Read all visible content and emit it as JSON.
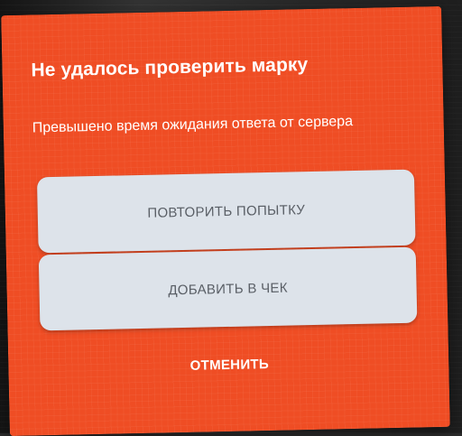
{
  "dialog": {
    "title": "Не удалось проверить марку",
    "message": "Превышено время ожидания ответа от сервера",
    "retry_label": "ПОВТОРИТЬ ПОПЫТКУ",
    "add_label": "ДОБАВИТЬ В ЧЕК",
    "cancel_label": "ОТМЕНИТЬ"
  },
  "colors": {
    "dialog_background": "#ef4d24",
    "button_background": "#dde3ea",
    "button_text": "#5a5f66",
    "title_text": "#ffffff"
  }
}
